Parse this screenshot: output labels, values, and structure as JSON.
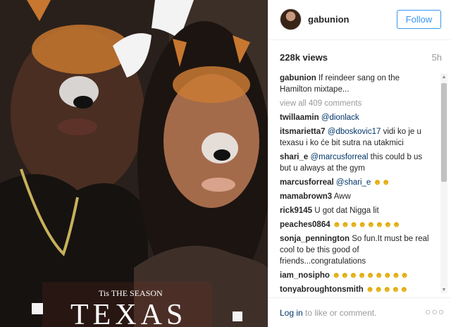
{
  "post": {
    "username": "gabunion",
    "follow_label": "Follow",
    "views": "228k views",
    "time": "5h",
    "photo_caption_overlay": "Tis THE SEASON",
    "photo_overlay_word": "TEXAS"
  },
  "caption": {
    "user": "gabunion",
    "text": "If reindeer sang on the Hamilton mixtape..."
  },
  "view_all": "view all 409 comments",
  "comments": [
    {
      "user": "twillaamin",
      "mention": "@dionlack",
      "text": ""
    },
    {
      "user": "itsmarietta7",
      "mention": "@dboskovic17",
      "text": " vidi ko je u texasu i ko će bit sutra na utakmici"
    },
    {
      "user": "shari_e",
      "mention": "@marcusforreal",
      "text": " this could b us but u always at the gym"
    },
    {
      "user": "marcusforreal",
      "mention": "@shari_e",
      "text": " ☻☻"
    },
    {
      "user": "mamabrown3",
      "mention": "",
      "text": "Aww"
    },
    {
      "user": "rick9145",
      "mention": "",
      "text": "U got dat Nigga lit"
    },
    {
      "user": "peaches0864",
      "mention": "",
      "text": "☻☻☻☻☻☻☻☻"
    },
    {
      "user": "sonja_pennington",
      "mention": "",
      "text": "So fun.It must be real cool to be this good of friends...congratulations"
    },
    {
      "user": "iam_nosipho",
      "mention": "",
      "text": "☻☻☻☻☻☻☻☻☻"
    },
    {
      "user": "tonyabroughtonsmith",
      "mention": "",
      "text": "☻☻☻☻☻"
    }
  ],
  "footer": {
    "login_link": "Log in",
    "login_rest": " to like or comment.",
    "more_icon": "more-dots-icon"
  },
  "colors": {
    "accent": "#3897f0",
    "link": "#003569",
    "muted": "#999999"
  }
}
